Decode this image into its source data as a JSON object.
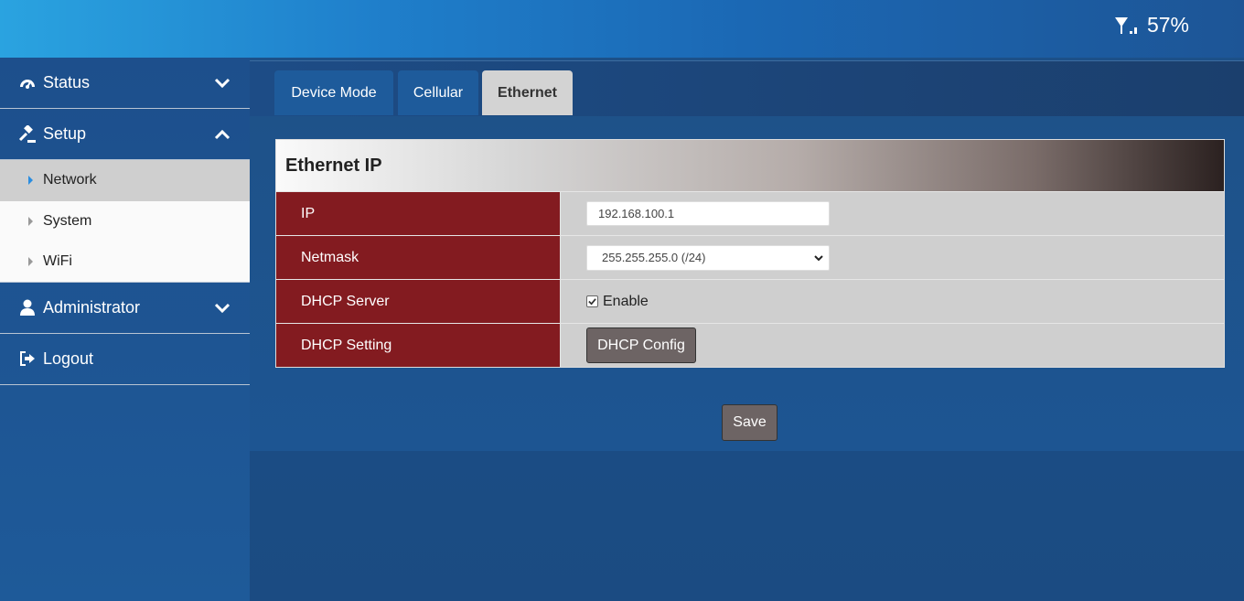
{
  "status_bar": {
    "signal_icon": "signal-weak-icon",
    "battery": "57%"
  },
  "sidebar": {
    "items": [
      {
        "label": "Status",
        "icon": "dashboard-icon",
        "expanded": false
      },
      {
        "label": "Setup",
        "icon": "gavel-icon",
        "expanded": true,
        "children": [
          {
            "label": "Network",
            "active": true
          },
          {
            "label": "System"
          },
          {
            "label": "WiFi"
          }
        ]
      },
      {
        "label": "Administrator",
        "icon": "user-icon",
        "expanded": false
      },
      {
        "label": "Logout",
        "icon": "logout-icon"
      }
    ]
  },
  "tabs": [
    {
      "label": "Device Mode",
      "active": false
    },
    {
      "label": "Cellular",
      "active": false
    },
    {
      "label": "Ethernet",
      "active": true
    }
  ],
  "card": {
    "title": "Ethernet IP",
    "ip": {
      "label": "IP",
      "value": "192.168.100.1"
    },
    "netmask": {
      "label": "Netmask",
      "selected": "255.255.255.0 (/24)"
    },
    "dhcp_server": {
      "label": "DHCP Server",
      "checkbox_label": "Enable",
      "checked": true
    },
    "dhcp_setting": {
      "label": "DHCP Setting",
      "button_label": "DHCP Config"
    }
  },
  "save_label": "Save",
  "colors": {
    "header_top": "#2aa3e0",
    "row_label": "#831b20",
    "tab_active": "#d3d3d3",
    "button": "#6d6464"
  }
}
